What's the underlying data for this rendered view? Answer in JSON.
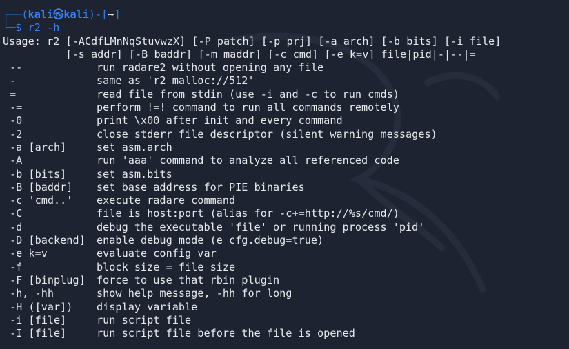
{
  "prompt": {
    "corner_top": "┌──(",
    "user": "kali㉿kali",
    "close": ")-[",
    "cwd": "~",
    "end": "]",
    "corner_bottom": "└─",
    "dollar": "$",
    "command": "r2 -h"
  },
  "usage": {
    "line1": "Usage: r2 [-ACdfLMnNqStuvwzX] [-P patch] [-p prj] [-a arch] [-b bits] [-i file]",
    "line2": "          [-s addr] [-B baddr] [-m maddr] [-c cmd] [-e k=v] file|pid|-|--|="
  },
  "options": [
    {
      "flag": "--",
      "desc": "run radare2 without opening any file"
    },
    {
      "flag": "-",
      "desc": "same as 'r2 malloc://512'"
    },
    {
      "flag": "=",
      "desc": "read file from stdin (use -i and -c to run cmds)"
    },
    {
      "flag": "-=",
      "desc": "perform !=! command to run all commands remotely"
    },
    {
      "flag": "-0",
      "desc": "print \\x00 after init and every command"
    },
    {
      "flag": "-2",
      "desc": "close stderr file descriptor (silent warning messages)"
    },
    {
      "flag": "-a [arch]",
      "desc": "set asm.arch"
    },
    {
      "flag": "-A",
      "desc": "run 'aaa' command to analyze all referenced code"
    },
    {
      "flag": "-b [bits]",
      "desc": "set asm.bits"
    },
    {
      "flag": "-B [baddr]",
      "desc": "set base address for PIE binaries"
    },
    {
      "flag": "-c 'cmd..'",
      "desc": "execute radare command"
    },
    {
      "flag": "-C",
      "desc": "file is host:port (alias for -c+=http://%s/cmd/)"
    },
    {
      "flag": "-d",
      "desc": "debug the executable 'file' or running process 'pid'"
    },
    {
      "flag": "-D [backend]",
      "desc": "enable debug mode (e cfg.debug=true)"
    },
    {
      "flag": "-e k=v",
      "desc": "evaluate config var"
    },
    {
      "flag": "-f",
      "desc": "block size = file size"
    },
    {
      "flag": "-F [binplug]",
      "desc": "force to use that rbin plugin"
    },
    {
      "flag": "-h, -hh",
      "desc": "show help message, -hh for long"
    },
    {
      "flag": "-H ([var])",
      "desc": "display variable"
    },
    {
      "flag": "-i [file]",
      "desc": "run script file"
    },
    {
      "flag": "-I [file]",
      "desc": "run script file before the file is opened"
    }
  ],
  "colors": {
    "background": "#1e2331",
    "text": "#e6e8ec",
    "prompt_blue": "#3b82f6"
  }
}
